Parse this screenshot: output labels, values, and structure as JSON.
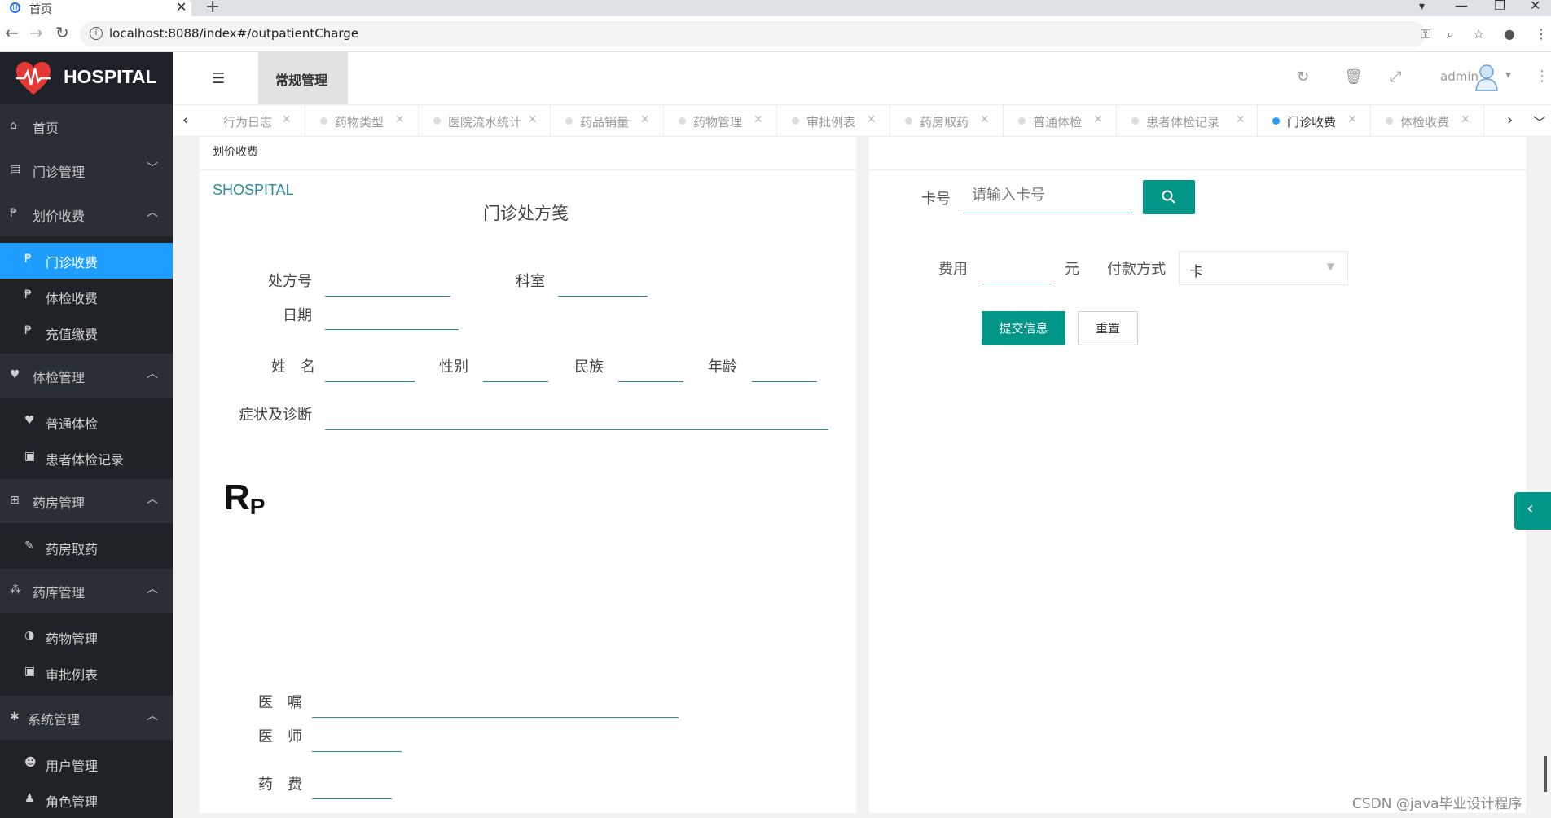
{
  "browser": {
    "tab_title": "首页",
    "url": "localhost:8088/index#/outpatientCharge"
  },
  "sidebar": {
    "logo_text": "HOSPITAL",
    "home": "首页",
    "groups": [
      {
        "label": "门诊管理",
        "expanded": false,
        "children": []
      },
      {
        "label": "划价收费",
        "expanded": true,
        "children": [
          "门诊收费",
          "体检收费",
          "充值缴费"
        ]
      },
      {
        "label": "体检管理",
        "expanded": true,
        "children": [
          "普通体检",
          "患者体检记录"
        ]
      },
      {
        "label": "药房管理",
        "expanded": true,
        "children": [
          "药房取药"
        ]
      },
      {
        "label": "药库管理",
        "expanded": true,
        "children": [
          "药物管理",
          "审批例表"
        ]
      },
      {
        "label": "系统管理",
        "expanded": true,
        "children": [
          "用户管理",
          "角色管理"
        ]
      }
    ],
    "active_item": "门诊收费"
  },
  "header": {
    "current_tab": "常规管理",
    "username": "admin"
  },
  "tabs": [
    "行为日志",
    "药物类型",
    "医院流水统计",
    "药品销量",
    "药物管理",
    "审批例表",
    "药房取药",
    "普通体检",
    "患者体检记录",
    "门诊收费",
    "体检收费"
  ],
  "active_tab": "门诊收费",
  "prescription": {
    "breadcrumb": "划价收费",
    "brand": "SHOSPITAL",
    "title": "门诊处方笺",
    "labels": {
      "rx_no": "处方号",
      "department": "科室",
      "date": "日期",
      "name": "姓　名",
      "gender": "性别",
      "ethnicity": "民族",
      "age": "年龄",
      "diagnosis": "症状及诊断",
      "rp_main": "R",
      "rp_sub": "P",
      "advice": "医　嘱",
      "doctor": "医　师",
      "fee": "药　费"
    }
  },
  "payment": {
    "card_label": "卡号",
    "card_placeholder": "请输入卡号",
    "fee_label": "费用",
    "unit": "元",
    "method_label": "付款方式",
    "method_value": "卡",
    "submit": "提交信息",
    "reset": "重置"
  },
  "watermark": "CSDN @java毕业设计程序",
  "colors": {
    "sidebar_bg": "#1f2226",
    "active_blue": "#1e9fff",
    "teal": "#009688",
    "brand_teal": "#2f8a9a"
  }
}
